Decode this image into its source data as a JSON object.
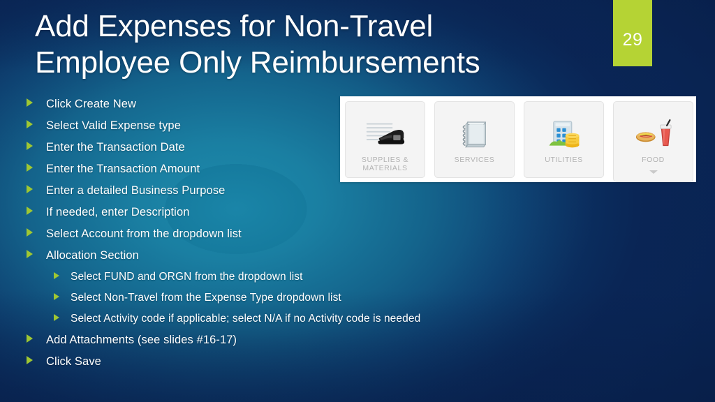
{
  "slide": {
    "title": "Add Expenses for Non-Travel\nEmployee Only Reimbursements",
    "number": "29",
    "accent_green": "#b5d334",
    "bullet_green": "#9fc732",
    "background_navy": "#0d2b56",
    "background_teal": "#1a85a8"
  },
  "bullets": [
    {
      "level": 1,
      "text": "Click Create New"
    },
    {
      "level": 1,
      "text": "Select Valid Expense type"
    },
    {
      "level": 1,
      "text": "Enter the Transaction Date"
    },
    {
      "level": 1,
      "text": "Enter the Transaction Amount"
    },
    {
      "level": 1,
      "text": "Enter a detailed Business Purpose"
    },
    {
      "level": 1,
      "text": "If needed, enter Description"
    },
    {
      "level": 1,
      "text": "Select Account from the dropdown list"
    },
    {
      "level": 1,
      "text": "Allocation Section"
    },
    {
      "level": 2,
      "text": "Select FUND and ORGN from the dropdown list"
    },
    {
      "level": 2,
      "text": "Select Non-Travel from the Expense Type dropdown list"
    },
    {
      "level": 2,
      "text": "Select Activity code if applicable; select N/A if no Activity code is needed"
    },
    {
      "level": 1,
      "text": "Add Attachments (see slides #16-17)"
    },
    {
      "level": 1,
      "text": "Click Save"
    }
  ],
  "expense_cards": [
    {
      "label": "SUPPLIES &\nMATERIALS",
      "icon": "stapler-icon",
      "has_caret": false
    },
    {
      "label": "SERVICES",
      "icon": "notebook-icon",
      "has_caret": false
    },
    {
      "label": "UTILITIES",
      "icon": "building-coins-icon",
      "has_caret": false
    },
    {
      "label": "FOOD",
      "icon": "food-drink-icon",
      "has_caret": true
    }
  ]
}
